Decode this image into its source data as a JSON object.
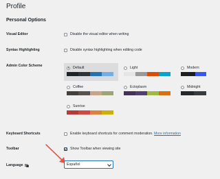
{
  "page": {
    "title": "Profile",
    "section_heading": "Personal Options"
  },
  "visual_editor": {
    "label": "Visual Editor",
    "checkbox_label": "Disable the visual editor when writing",
    "checked": false
  },
  "syntax_highlighting": {
    "label": "Syntax Highlighting",
    "checkbox_label": "Disable syntax highlighting when editing code",
    "checked": false
  },
  "admin_color_scheme": {
    "label": "Admin Color Scheme",
    "schemes": [
      {
        "name": "Default",
        "selected": true,
        "colors": [
          "#1d2327",
          "#2c3338",
          "#2271b1",
          "#72aee6"
        ]
      },
      {
        "name": "Light",
        "selected": false,
        "colors": [
          "#e5e5e5",
          "#999999",
          "#d64e07",
          "#04a4cc"
        ]
      },
      {
        "name": "Modern",
        "selected": false,
        "colors": [
          "#1e1e1e",
          "#3858e9",
          "#33f078"
        ]
      },
      {
        "name": "Coffee",
        "selected": false,
        "colors": [
          "#46403c",
          "#59524c",
          "#c7a589",
          "#9ea476"
        ]
      },
      {
        "name": "Ectoplasm",
        "selected": false,
        "colors": [
          "#413256",
          "#523f6d",
          "#a3b745",
          "#d46f15"
        ]
      },
      {
        "name": "Midnight",
        "selected": false,
        "colors": [
          "#25282b",
          "#363b3f",
          "#69a8bb",
          "#e14d43"
        ]
      },
      {
        "name": "Sunrise",
        "selected": false,
        "colors": [
          "#b43c38",
          "#cf4944",
          "#dd823b",
          "#ccaf0b"
        ]
      }
    ]
  },
  "keyboard_shortcuts": {
    "label": "Keyboard Shortcuts",
    "checkbox_label": "Enable keyboard shortcuts for comment moderation.",
    "link_text": "More information",
    "checked": false
  },
  "toolbar": {
    "label": "Toolbar",
    "checkbox_label": "Show Toolbar when viewing site",
    "checked": true
  },
  "language": {
    "label": "Language",
    "icon": "translation-icon",
    "selected": "Español"
  },
  "annotation": {
    "arrow_color": "#e2574c"
  }
}
